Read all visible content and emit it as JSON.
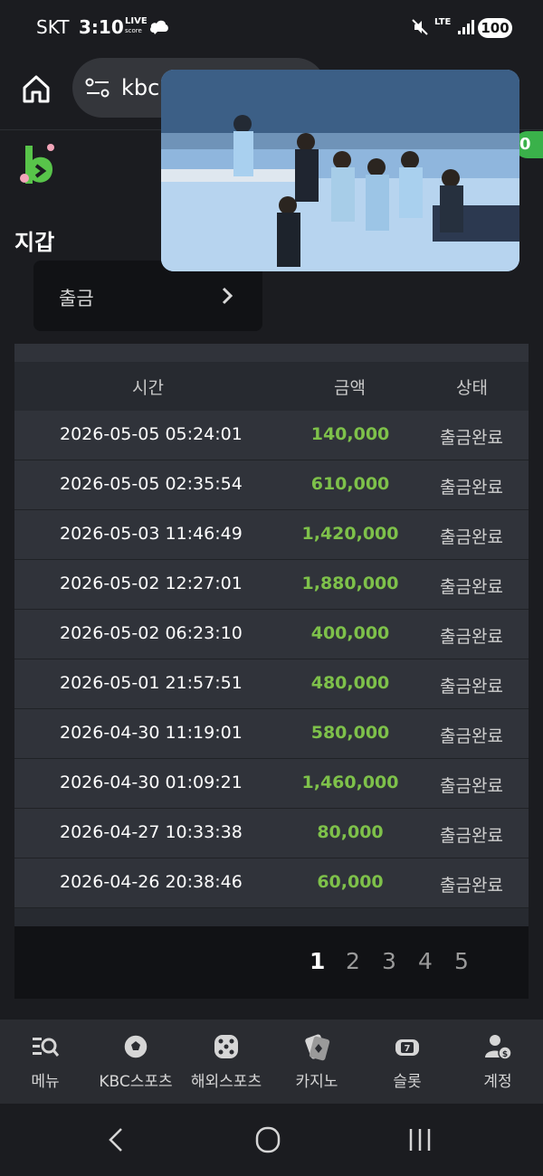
{
  "status_bar": {
    "carrier": "SKT",
    "time": "3:10",
    "live_top": "LIVE",
    "live_bottom": "score",
    "network": "LTE",
    "battery": "100"
  },
  "browser": {
    "url": "kbc"
  },
  "header": {
    "badge": "0"
  },
  "wallet": {
    "title": "지갑",
    "withdraw_label": "출금"
  },
  "table": {
    "headers": {
      "time": "시간",
      "amount": "금액",
      "status": "상태"
    },
    "rows": [
      {
        "time": "2026-05-05 05:24:01",
        "amount": "140,000",
        "status": "출금완료"
      },
      {
        "time": "2026-05-05 02:35:54",
        "amount": "610,000",
        "status": "출금완료"
      },
      {
        "time": "2026-05-03 11:46:49",
        "amount": "1,420,000",
        "status": "출금완료"
      },
      {
        "time": "2026-05-02 12:27:01",
        "amount": "1,880,000",
        "status": "출금완료"
      },
      {
        "time": "2026-05-02 06:23:10",
        "amount": "400,000",
        "status": "출금완료"
      },
      {
        "time": "2026-05-01 21:57:51",
        "amount": "480,000",
        "status": "출금완료"
      },
      {
        "time": "2026-04-30 11:19:01",
        "amount": "580,000",
        "status": "출금완료"
      },
      {
        "time": "2026-04-30 01:09:21",
        "amount": "1,460,000",
        "status": "출금완료"
      },
      {
        "time": "2026-04-27 10:33:38",
        "amount": "80,000",
        "status": "출금완료"
      },
      {
        "time": "2026-04-26 20:38:46",
        "amount": "60,000",
        "status": "출금완료"
      }
    ]
  },
  "pagination": {
    "pages": [
      "1",
      "2",
      "3",
      "4",
      "5"
    ],
    "current": "1"
  },
  "bottom_nav": {
    "items": [
      {
        "label": "메뉴",
        "icon": "menu-search-icon"
      },
      {
        "label": "KBC스포츠",
        "icon": "soccer-ball-icon"
      },
      {
        "label": "해외스포츠",
        "icon": "dice-icon"
      },
      {
        "label": "카지노",
        "icon": "casino-cards-icon"
      },
      {
        "label": "슬롯",
        "icon": "slot-machine-icon"
      },
      {
        "label": "계정",
        "icon": "account-money-icon"
      }
    ]
  },
  "colors": {
    "background": "#1b1c20",
    "amount_green": "#7ec14a",
    "brand_green": "#3ab14a"
  }
}
